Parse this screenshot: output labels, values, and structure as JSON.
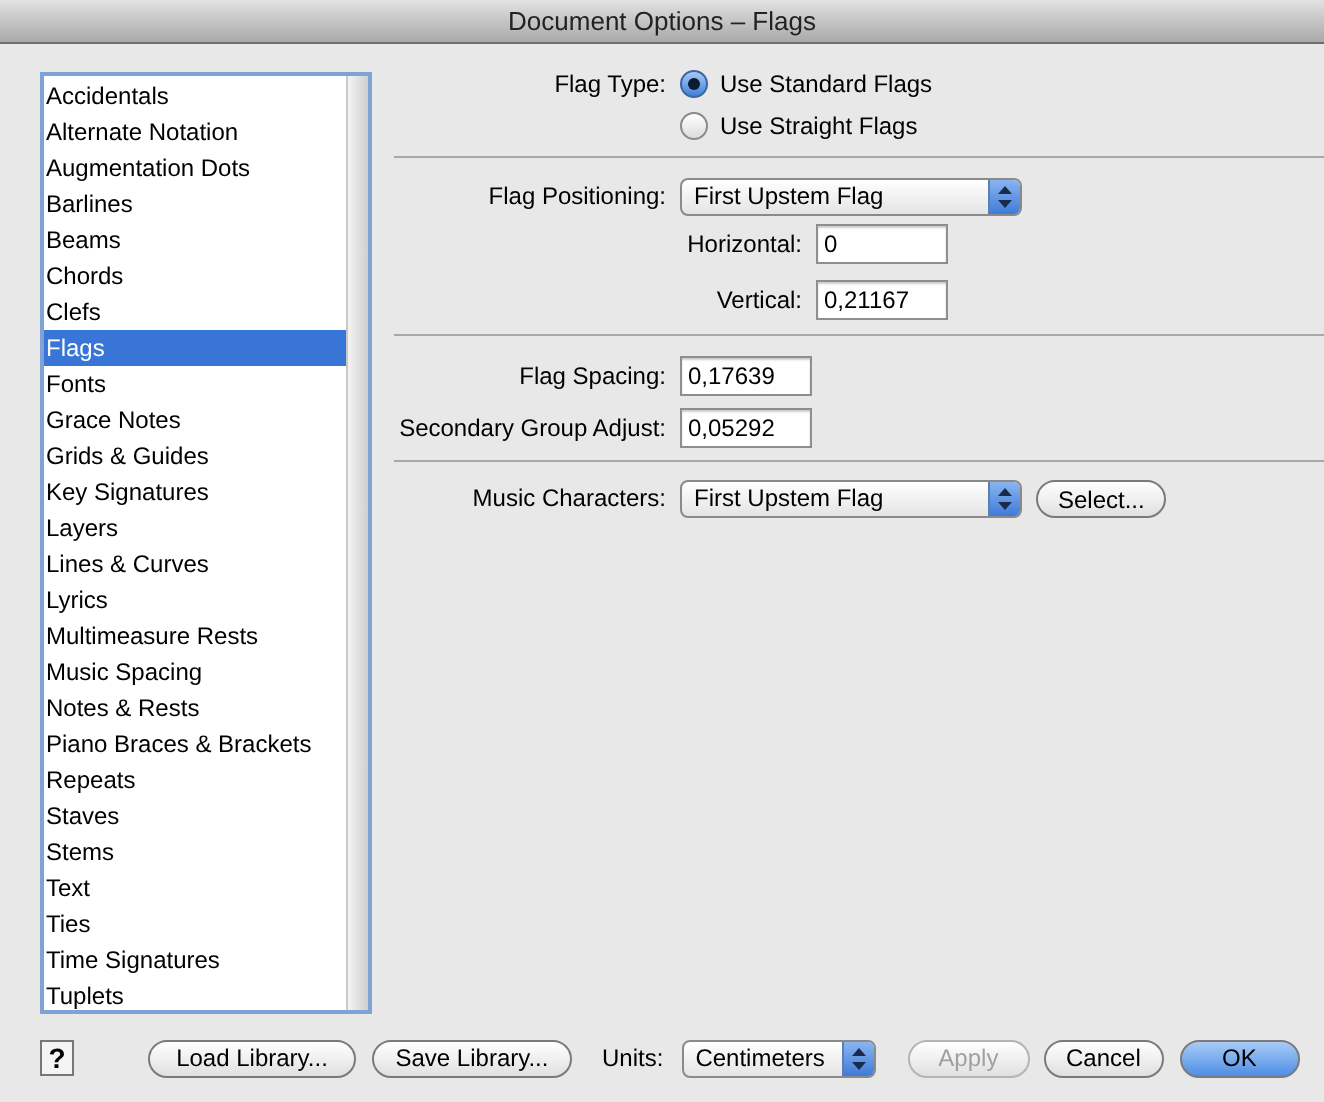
{
  "window": {
    "title": "Document Options – Flags"
  },
  "categories": [
    {
      "label": "Accidentals",
      "selected": false
    },
    {
      "label": "Alternate Notation",
      "selected": false
    },
    {
      "label": "Augmentation Dots",
      "selected": false
    },
    {
      "label": "Barlines",
      "selected": false
    },
    {
      "label": "Beams",
      "selected": false
    },
    {
      "label": "Chords",
      "selected": false
    },
    {
      "label": "Clefs",
      "selected": false
    },
    {
      "label": "Flags",
      "selected": true
    },
    {
      "label": "Fonts",
      "selected": false
    },
    {
      "label": "Grace Notes",
      "selected": false
    },
    {
      "label": "Grids & Guides",
      "selected": false
    },
    {
      "label": "Key Signatures",
      "selected": false
    },
    {
      "label": "Layers",
      "selected": false
    },
    {
      "label": "Lines & Curves",
      "selected": false
    },
    {
      "label": "Lyrics",
      "selected": false
    },
    {
      "label": "Multimeasure Rests",
      "selected": false
    },
    {
      "label": "Music Spacing",
      "selected": false
    },
    {
      "label": "Notes & Rests",
      "selected": false
    },
    {
      "label": "Piano Braces & Brackets",
      "selected": false
    },
    {
      "label": "Repeats",
      "selected": false
    },
    {
      "label": "Staves",
      "selected": false
    },
    {
      "label": "Stems",
      "selected": false
    },
    {
      "label": "Text",
      "selected": false
    },
    {
      "label": "Ties",
      "selected": false
    },
    {
      "label": "Time Signatures",
      "selected": false
    },
    {
      "label": "Tuplets",
      "selected": false
    }
  ],
  "flag_type": {
    "label": "Flag Type:",
    "options": [
      {
        "label": "Use Standard Flags",
        "selected": true
      },
      {
        "label": "Use Straight Flags",
        "selected": false
      }
    ]
  },
  "flag_positioning": {
    "label": "Flag Positioning:",
    "value": "First Upstem Flag",
    "horizontal": {
      "label": "Horizontal:",
      "value": "0"
    },
    "vertical": {
      "label": "Vertical:",
      "value": "0,21167"
    }
  },
  "flag_spacing": {
    "label": "Flag Spacing:",
    "value": "0,17639"
  },
  "secondary_group_adjust": {
    "label": "Secondary Group Adjust:",
    "value": "0,05292"
  },
  "music_characters": {
    "label": "Music Characters:",
    "value": "First Upstem Flag",
    "button": "Select..."
  },
  "help": "?",
  "library_buttons": [
    {
      "label": "Load Library...",
      "disabled": false
    },
    {
      "label": "Save Library...",
      "disabled": false
    }
  ],
  "units": {
    "label": "Units:",
    "value": "Centimeters"
  },
  "actions": [
    {
      "label": "Apply",
      "kind": "normal",
      "disabled": true
    },
    {
      "label": "Cancel",
      "kind": "normal",
      "disabled": false
    },
    {
      "label": "OK",
      "kind": "default",
      "disabled": false
    }
  ]
}
